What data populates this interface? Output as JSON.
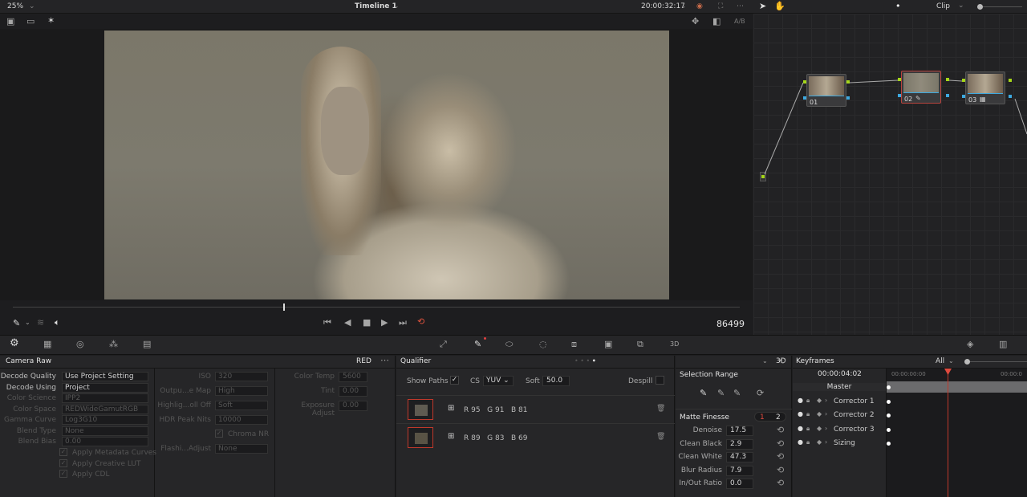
{
  "top": {
    "zoom": "25%",
    "timeline": "Timeline 1",
    "timecode": "20:00:32:17",
    "clip": "Clip",
    "ab": "A/B"
  },
  "viewer": {
    "frame": "86499"
  },
  "camera_raw": {
    "title": "Camera Raw",
    "mode": "RED",
    "rows": [
      {
        "label": "Decode Quality",
        "value": "Use Project Setting",
        "dim": false
      },
      {
        "label": "Decode Using",
        "value": "Project",
        "dim": false
      },
      {
        "label": "Color Science",
        "value": "IPP2",
        "dim": true
      },
      {
        "label": "Color Space",
        "value": "REDWideGamutRGB",
        "dim": true
      },
      {
        "label": "Gamma Curve",
        "value": "Log3G10",
        "dim": true
      },
      {
        "label": "Blend Type",
        "value": "None",
        "dim": true
      },
      {
        "label": "Blend Bias",
        "value": "0.00",
        "dim": true
      }
    ],
    "checks": [
      "Apply Metadata Curves",
      "Apply Creative LUT",
      "Apply CDL"
    ],
    "mid": [
      {
        "label": "ISO",
        "value": "320"
      },
      {
        "label": "Outpu...e Map",
        "value": "High"
      },
      {
        "label": "Highlig...oll Off",
        "value": "Soft"
      },
      {
        "label": "HDR Peak Nits",
        "value": "10000"
      },
      {
        "label": "Flashi...Adjust",
        "value": "None"
      }
    ],
    "chroma_nr": "Chroma NR",
    "right": [
      {
        "label": "Color Temp",
        "value": "5600"
      },
      {
        "label": "Tint",
        "value": "0.00"
      },
      {
        "label": "Exposure Adjust",
        "value": "0.00"
      }
    ]
  },
  "qualifier": {
    "title": "Qualifier",
    "mode": "3D",
    "show_paths": "Show Paths",
    "cs_label": "CS",
    "cs_value": "YUV",
    "soft_label": "Soft",
    "soft_value": "50.0",
    "despill": "Despill",
    "swatches": [
      {
        "rgb": "R 95   G 91   B 81",
        "color": "#5f5b51"
      },
      {
        "rgb": "R 89   G 83   B 69",
        "color": "#595345"
      }
    ]
  },
  "selection": {
    "title": "Selection Range",
    "finesse": "Matte Finesse",
    "tab1": "1",
    "tab2": "2",
    "params": [
      {
        "label": "Denoise",
        "value": "17.5"
      },
      {
        "label": "Clean Black",
        "value": "2.9"
      },
      {
        "label": "Clean White",
        "value": "47.3"
      },
      {
        "label": "Blur Radius",
        "value": "7.9"
      },
      {
        "label": "In/Out Ratio",
        "value": "0.0"
      }
    ]
  },
  "keyframes": {
    "title": "Keyframes",
    "filter": "All",
    "time": "00:00:04:02",
    "ruler1": "00:00:00:00",
    "ruler2": "00:00:0",
    "tracks": [
      "Master",
      "Corrector 1",
      "Corrector 2",
      "Corrector 3",
      "Sizing"
    ]
  },
  "nodes": [
    "01",
    "02",
    "03"
  ]
}
